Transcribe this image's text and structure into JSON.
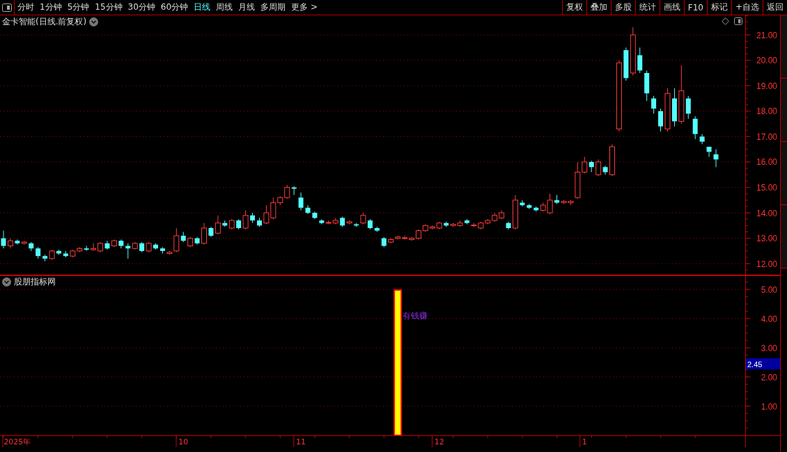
{
  "toolbar": {
    "periods": [
      {
        "label": "分时",
        "selected": false
      },
      {
        "label": "1分钟",
        "selected": false
      },
      {
        "label": "5分钟",
        "selected": false
      },
      {
        "label": "15分钟",
        "selected": false
      },
      {
        "label": "30分钟",
        "selected": false
      },
      {
        "label": "60分钟",
        "selected": false
      },
      {
        "label": "日线",
        "selected": true
      },
      {
        "label": "周线",
        "selected": false
      },
      {
        "label": "月线",
        "selected": false
      },
      {
        "label": "多周期",
        "selected": false
      }
    ],
    "more": "更多 >",
    "buttons": [
      "复权",
      "叠加",
      "多股",
      "统计",
      "画线",
      "F10",
      "标记",
      "+自选",
      "返回"
    ]
  },
  "main_panel": {
    "title": "金卡智能(日线.前复权)",
    "chart_data": {
      "type": "candlestick",
      "grid": true,
      "ylim": [
        11.54,
        21.77
      ],
      "categories": [
        null,
        null,
        null,
        null,
        null,
        null,
        null,
        null,
        null,
        null,
        null,
        null,
        null,
        null,
        null,
        null,
        null,
        null,
        null,
        null,
        null,
        null,
        null,
        null,
        null,
        null,
        null,
        null,
        null,
        null,
        null,
        null,
        null,
        null,
        null,
        null,
        null,
        null,
        null,
        null,
        null,
        null,
        null,
        null,
        null,
        null,
        null,
        null,
        null,
        null,
        null,
        null,
        null,
        null,
        null,
        null,
        null,
        null,
        null,
        null,
        null,
        null,
        null,
        null,
        null,
        null,
        null,
        null,
        null,
        null,
        null,
        null,
        null,
        null,
        null,
        null,
        null,
        null,
        null,
        null,
        null,
        null,
        null,
        null,
        null,
        null,
        null,
        null,
        null,
        null,
        null,
        null,
        null,
        null,
        null,
        null,
        null,
        null,
        null,
        null,
        null,
        null,
        null,
        null
      ],
      "yticks": [
        {
          "value": 12,
          "label": "12.00"
        },
        {
          "value": 13,
          "label": "13.00"
        },
        {
          "value": 14,
          "label": "14.00"
        },
        {
          "value": 15,
          "label": "15.00"
        },
        {
          "value": 16,
          "label": "16.00"
        },
        {
          "value": 17,
          "label": "17.00"
        },
        {
          "value": 18,
          "label": "18.00"
        },
        {
          "value": 19,
          "label": "19.00"
        },
        {
          "value": 20,
          "label": "20.00"
        },
        {
          "value": 21,
          "label": "21.00"
        }
      ],
      "ohlc": [
        [
          13.0,
          13.3,
          12.6,
          12.7
        ],
        [
          12.7,
          13.0,
          12.6,
          12.9
        ],
        [
          12.9,
          12.95,
          12.75,
          12.8
        ],
        [
          12.8,
          12.9,
          12.75,
          12.85
        ],
        [
          12.8,
          12.85,
          12.5,
          12.6
        ],
        [
          12.6,
          12.65,
          12.2,
          12.3
        ],
        [
          12.3,
          12.35,
          12.1,
          12.2
        ],
        [
          12.2,
          12.55,
          12.15,
          12.5
        ],
        [
          12.5,
          12.55,
          12.35,
          12.4
        ],
        [
          12.4,
          12.5,
          12.25,
          12.3
        ],
        [
          12.3,
          12.55,
          12.25,
          12.5
        ],
        [
          12.5,
          12.65,
          12.45,
          12.6
        ],
        [
          12.6,
          12.7,
          12.5,
          12.55
        ],
        [
          12.55,
          12.8,
          12.5,
          12.6
        ],
        [
          12.5,
          12.85,
          12.45,
          12.8
        ],
        [
          12.8,
          12.9,
          12.55,
          12.6
        ],
        [
          12.7,
          12.95,
          12.65,
          12.9
        ],
        [
          12.9,
          12.95,
          12.6,
          12.7
        ],
        [
          12.7,
          12.8,
          12.2,
          12.6
        ],
        [
          12.6,
          12.85,
          12.55,
          12.8
        ],
        [
          12.8,
          12.85,
          12.45,
          12.5
        ],
        [
          12.5,
          12.85,
          12.45,
          12.8
        ],
        [
          12.75,
          12.8,
          12.55,
          12.6
        ],
        [
          12.6,
          12.65,
          12.4,
          12.5
        ],
        [
          12.4,
          12.5,
          12.35,
          12.45
        ],
        [
          12.5,
          13.4,
          12.45,
          13.1
        ],
        [
          13.1,
          13.25,
          12.85,
          12.9
        ],
        [
          12.7,
          13.05,
          12.65,
          13.0
        ],
        [
          13.0,
          13.05,
          12.75,
          12.8
        ],
        [
          12.8,
          13.6,
          12.75,
          13.4
        ],
        [
          13.4,
          13.45,
          13.05,
          13.1
        ],
        [
          13.2,
          13.9,
          13.15,
          13.6
        ],
        [
          13.6,
          13.7,
          13.45,
          13.5
        ],
        [
          13.4,
          13.75,
          13.35,
          13.7
        ],
        [
          13.7,
          13.75,
          13.35,
          13.4
        ],
        [
          13.4,
          14.1,
          13.35,
          13.9
        ],
        [
          13.9,
          14.0,
          13.6,
          13.7
        ],
        [
          13.7,
          13.8,
          13.45,
          13.5
        ],
        [
          13.6,
          14.3,
          13.55,
          14.0
        ],
        [
          13.8,
          14.6,
          13.75,
          14.4
        ],
        [
          14.4,
          14.65,
          14.3,
          14.6
        ],
        [
          14.6,
          15.1,
          14.55,
          15.0
        ],
        [
          15.0,
          15.05,
          14.7,
          14.95
        ],
        [
          14.6,
          14.8,
          14.1,
          14.2
        ],
        [
          14.2,
          14.3,
          13.95,
          14.0
        ],
        [
          14.0,
          14.05,
          13.75,
          13.8
        ],
        [
          13.7,
          13.75,
          13.55,
          13.6
        ],
        [
          13.6,
          13.7,
          13.55,
          13.62
        ],
        [
          13.6,
          13.8,
          13.55,
          13.7
        ],
        [
          13.8,
          13.85,
          13.45,
          13.5
        ],
        [
          13.6,
          13.7,
          13.55,
          13.65
        ],
        [
          13.55,
          13.6,
          13.45,
          13.5
        ],
        [
          13.6,
          14.0,
          13.55,
          13.9
        ],
        [
          13.7,
          13.75,
          13.35,
          13.4
        ],
        [
          13.4,
          13.45,
          13.25,
          13.3
        ],
        [
          13.0,
          13.05,
          12.65,
          12.7
        ],
        [
          12.85,
          13.0,
          12.8,
          12.95
        ],
        [
          13.0,
          13.1,
          12.95,
          13.05
        ],
        [
          13.0,
          13.1,
          12.95,
          13.02
        ],
        [
          12.95,
          13.05,
          12.9,
          13.0
        ],
        [
          13.0,
          13.35,
          12.95,
          13.3
        ],
        [
          13.3,
          13.55,
          13.25,
          13.5
        ],
        [
          13.4,
          13.5,
          13.35,
          13.45
        ],
        [
          13.4,
          13.65,
          13.35,
          13.6
        ],
        [
          13.6,
          13.65,
          13.45,
          13.5
        ],
        [
          13.5,
          13.6,
          13.45,
          13.55
        ],
        [
          13.5,
          13.7,
          13.45,
          13.6
        ],
        [
          13.7,
          13.75,
          13.55,
          13.6
        ],
        [
          13.5,
          13.6,
          13.45,
          13.52
        ],
        [
          13.4,
          13.65,
          13.35,
          13.6
        ],
        [
          13.6,
          13.75,
          13.55,
          13.7
        ],
        [
          13.7,
          14.0,
          13.65,
          13.9
        ],
        [
          13.8,
          14.1,
          13.75,
          14.0
        ],
        [
          13.6,
          13.65,
          13.35,
          13.4
        ],
        [
          13.4,
          14.7,
          13.35,
          14.5
        ],
        [
          14.4,
          14.5,
          14.25,
          14.3
        ],
        [
          14.3,
          14.35,
          14.15,
          14.2
        ],
        [
          14.2,
          14.25,
          14.05,
          14.1
        ],
        [
          14.1,
          14.4,
          14.05,
          14.3
        ],
        [
          14.0,
          14.75,
          13.95,
          14.5
        ],
        [
          14.5,
          14.7,
          14.35,
          14.4
        ],
        [
          14.4,
          14.5,
          14.35,
          14.45
        ],
        [
          14.4,
          14.5,
          14.3,
          14.45
        ],
        [
          14.6,
          16.0,
          14.55,
          15.6
        ],
        [
          15.6,
          16.2,
          15.55,
          16.0
        ],
        [
          16.0,
          16.05,
          15.6,
          15.8
        ],
        [
          15.5,
          16.1,
          15.45,
          16.0
        ],
        [
          15.8,
          15.85,
          15.5,
          15.6
        ],
        [
          15.5,
          16.7,
          15.45,
          16.6
        ],
        [
          17.3,
          20.0,
          17.2,
          19.9
        ],
        [
          20.4,
          20.5,
          19.2,
          19.3
        ],
        [
          19.5,
          21.3,
          19.4,
          21.0
        ],
        [
          20.2,
          20.5,
          19.5,
          19.6
        ],
        [
          19.5,
          19.6,
          18.4,
          18.7
        ],
        [
          18.5,
          18.6,
          17.9,
          18.1
        ],
        [
          18.0,
          18.1,
          17.2,
          17.4
        ],
        [
          17.3,
          18.9,
          17.2,
          18.7
        ],
        [
          18.5,
          18.9,
          17.4,
          17.6
        ],
        [
          17.6,
          19.8,
          17.5,
          18.8
        ],
        [
          18.5,
          18.6,
          17.7,
          17.9
        ],
        [
          17.7,
          17.8,
          16.9,
          17.1
        ],
        [
          17.0,
          17.1,
          16.7,
          16.8
        ],
        [
          16.6,
          16.6,
          16.2,
          16.4
        ],
        [
          16.3,
          16.5,
          15.8,
          16.1
        ]
      ]
    }
  },
  "lower_panel": {
    "title": "股朋指标网",
    "cursor_value": "2.45",
    "chart_data": {
      "type": "bar",
      "grid": true,
      "ylim": [
        0,
        5.48
      ],
      "categories": [
        null,
        null,
        "2025年",
        null,
        null,
        null,
        null,
        null,
        null,
        null,
        null,
        null,
        null,
        null,
        null,
        null,
        null,
        null,
        null,
        null,
        null,
        null,
        null,
        null,
        null,
        null,
        "10",
        null,
        null,
        null,
        null,
        null,
        null,
        null,
        null,
        null,
        null,
        null,
        null,
        null,
        null,
        null,
        null,
        "11",
        null,
        null,
        null,
        null,
        null,
        null,
        null,
        null,
        null,
        null,
        null,
        null,
        null,
        null,
        null,
        null,
        null,
        null,
        null,
        "12",
        null,
        null,
        null,
        null,
        null,
        null,
        null,
        null,
        null,
        null,
        null,
        null,
        null,
        null,
        null,
        null,
        null,
        null,
        null,
        null,
        "1",
        null,
        null,
        null,
        null,
        null,
        null,
        null,
        null,
        null,
        null,
        null,
        null,
        null,
        null,
        null,
        null,
        null,
        null,
        null
      ],
      "yticks": [
        {
          "value": 1,
          "label": "1.00"
        },
        {
          "value": 2,
          "label": "2.00"
        },
        {
          "value": 3,
          "label": "3.00"
        },
        {
          "value": 4,
          "label": "4.00"
        },
        {
          "value": 5,
          "label": "5.00"
        }
      ],
      "values": [
        null,
        null,
        null,
        null,
        null,
        null,
        null,
        null,
        null,
        null,
        null,
        null,
        null,
        null,
        null,
        null,
        null,
        null,
        null,
        null,
        null,
        null,
        null,
        null,
        null,
        null,
        null,
        null,
        null,
        null,
        null,
        null,
        null,
        null,
        null,
        null,
        null,
        null,
        null,
        null,
        null,
        null,
        null,
        null,
        null,
        null,
        null,
        null,
        null,
        null,
        null,
        null,
        null,
        null,
        null,
        null,
        null,
        5,
        null,
        null,
        null,
        null,
        null,
        null,
        null,
        null,
        null,
        null,
        null,
        null,
        null,
        null,
        null,
        null,
        null,
        null,
        null,
        null,
        null,
        null,
        null,
        null,
        null,
        null,
        null,
        null,
        null,
        null,
        null,
        null,
        null,
        null,
        null,
        null,
        null,
        null,
        null,
        null,
        null,
        null,
        null,
        null,
        null,
        null
      ],
      "annotations": [
        {
          "text": "有钱赚"
        }
      ]
    }
  }
}
